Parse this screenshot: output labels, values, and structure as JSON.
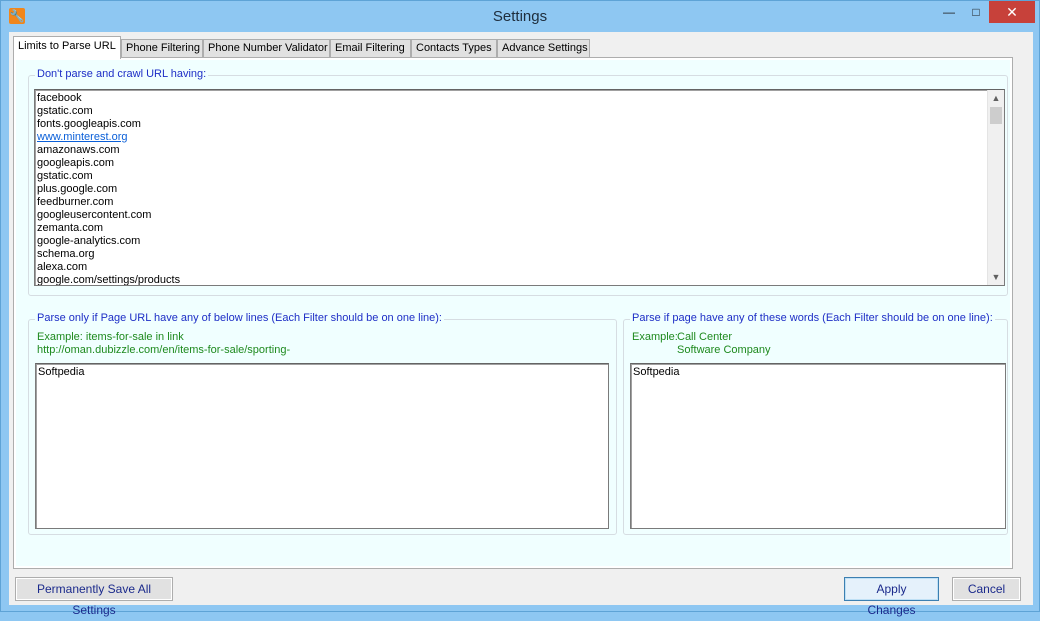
{
  "window": {
    "title": "Settings",
    "icon": "wrench-icon",
    "controls": {
      "minimize": "—",
      "maximize": "□",
      "close": "✕"
    }
  },
  "tabs": [
    {
      "label": "Limits to Parse URL",
      "active": true
    },
    {
      "label": "Phone Filtering"
    },
    {
      "label": "Phone Number Validator"
    },
    {
      "label": "Email Filtering"
    },
    {
      "label": "Contacts Types"
    },
    {
      "label": "Advance Settings"
    }
  ],
  "exclude_group": {
    "title": "Don't parse and crawl URL having:",
    "items": [
      "facebook",
      "gstatic.com",
      "fonts.googleapis.com",
      "www.minterest.org",
      "amazonaws.com",
      "googleapis.com",
      "gstatic.com",
      "plus.google.com",
      "feedburner.com",
      "googleusercontent.com",
      "zemanta.com",
      "google-analytics.com",
      "schema.org",
      "alexa.com",
      "google.com/settings/products"
    ]
  },
  "url_group": {
    "title": "Parse only if Page URL have any of below lines (Each Filter should be on one line):",
    "example_line1": "Example: items-for-sale in link",
    "example_line2": "http://oman.dubizzle.com/en/items-for-sale/sporting-",
    "value": "Softpedia"
  },
  "words_group": {
    "title": "Parse if page have any of these words (Each Filter should be on one line):",
    "example_prefix": "Example:",
    "example_line1": "Call Center",
    "example_line2": "Software Company",
    "value": "Softpedia"
  },
  "buttons": {
    "save_all": "Permanently Save All Settings",
    "apply": "Apply Changes",
    "cancel": "Cancel"
  },
  "colors": {
    "accent_blue": "#1d2ec6",
    "example_green": "#1e8a1e",
    "tab_background": "#f0ffff",
    "close_red": "#c7413a"
  }
}
